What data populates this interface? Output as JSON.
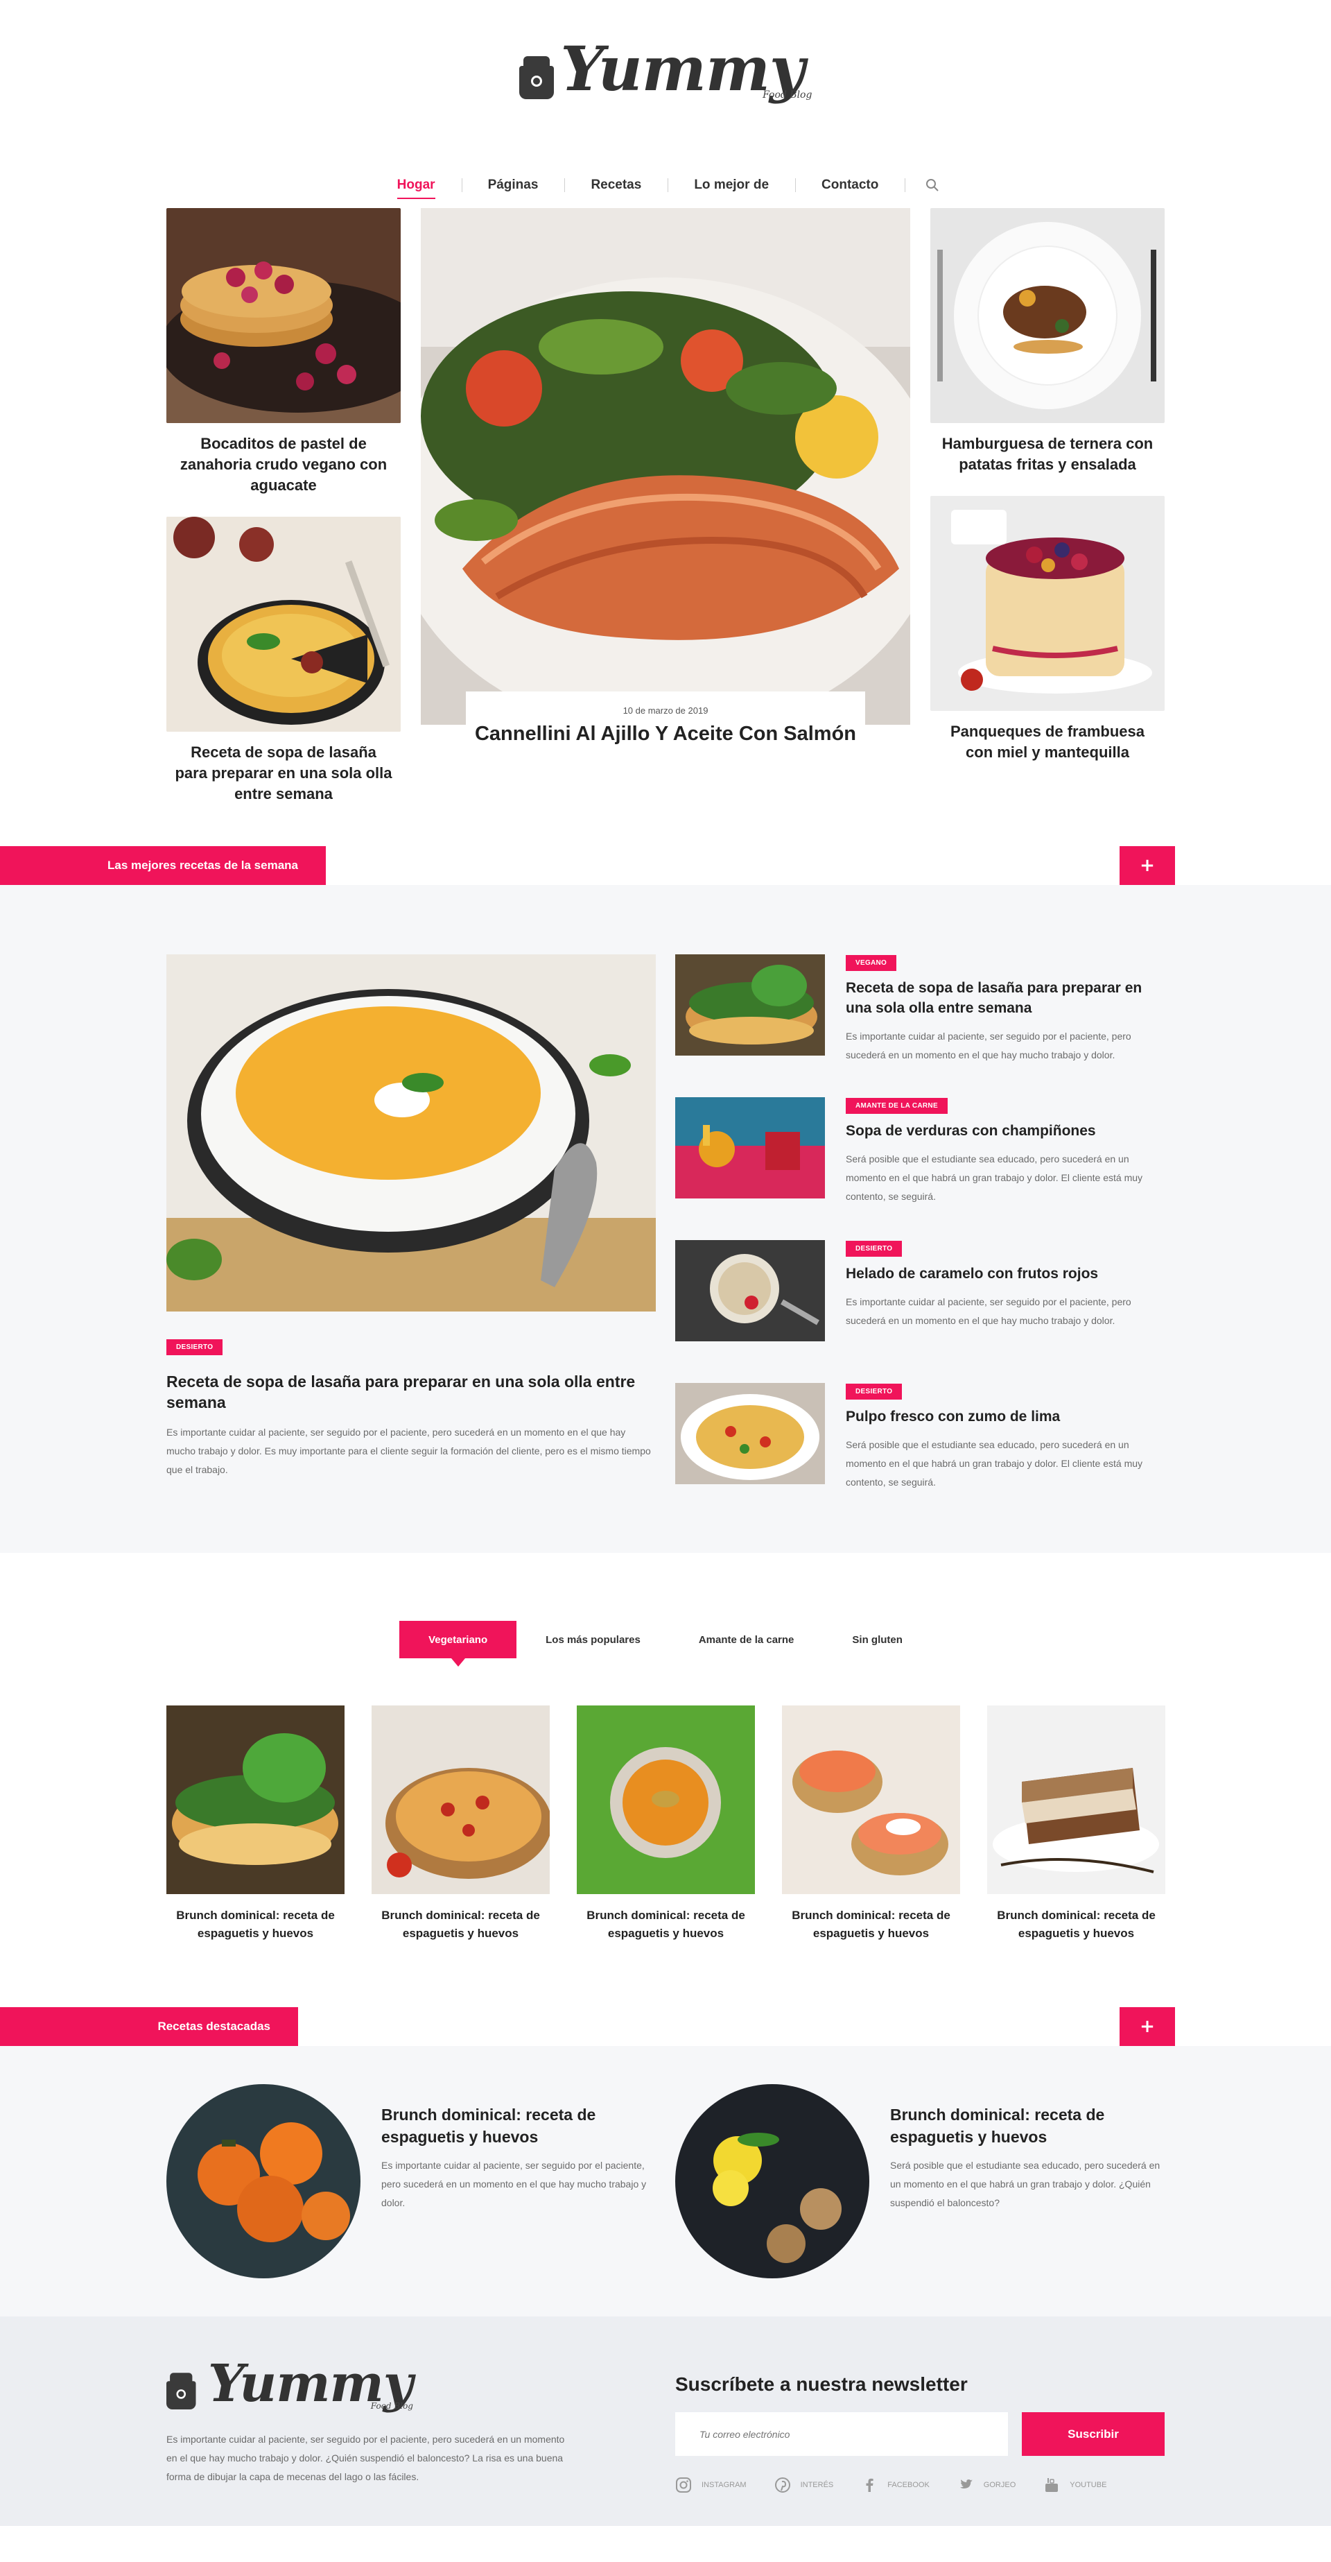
{
  "brand": {
    "name": "Yummy",
    "tagline": "Food Blog"
  },
  "nav": {
    "items": [
      {
        "label": "Hogar",
        "active": true
      },
      {
        "label": "Páginas"
      },
      {
        "label": "Recetas"
      },
      {
        "label": "Lo mejor de"
      },
      {
        "label": "Contacto"
      }
    ],
    "search_icon": "search-icon"
  },
  "hero": {
    "left": [
      {
        "title": "Bocaditos de pastel de zanahoria crudo vegano con aguacate"
      },
      {
        "title": "Receta de sopa de lasaña para preparar en una sola olla entre semana"
      }
    ],
    "feature": {
      "date": "10 de marzo de 2019",
      "title": "Cannellini Al Ajillo Y Aceite Con Salmón"
    },
    "right": [
      {
        "title": "Hamburguesa de ternera con patatas fritas y ensalada"
      },
      {
        "title": "Panqueques de frambuesa con miel y mantequilla"
      }
    ]
  },
  "best": {
    "section_label": "Las mejores recetas de la semana",
    "plus": "+",
    "big": {
      "tag": "DESIERTO",
      "title": "Receta de sopa de lasaña para preparar en una sola olla entre semana",
      "text": "Es importante cuidar al paciente, ser seguido por el paciente, pero sucederá en un momento en el que hay mucho trabajo y dolor. Es muy importante para el cliente seguir la formación del cliente, pero es el mismo tiempo que el trabajo."
    },
    "list": [
      {
        "tag": "VEGANO",
        "title": "Receta de sopa de lasaña para preparar en una sola olla entre semana",
        "text": "Es importante cuidar al paciente, ser seguido por el paciente, pero sucederá en un momento en el que hay mucho trabajo y dolor."
      },
      {
        "tag": "AMANTE DE LA CARNE",
        "title": "Sopa de verduras con champiñones",
        "text": "Será posible que el estudiante sea educado, pero sucederá en un momento en el que habrá un gran trabajo y dolor. El cliente está muy contento, se seguirá."
      },
      {
        "tag": "DESIERTO",
        "title": "Helado de caramelo con frutos rojos",
        "text": "Es importante cuidar al paciente, ser seguido por el paciente, pero sucederá en un momento en el que hay mucho trabajo y dolor."
      },
      {
        "tag": "DESIERTO",
        "title": "Pulpo fresco con zumo de lima",
        "text": "Será posible que el estudiante sea educado, pero sucederá en un momento en el que habrá un gran trabajo y dolor. El cliente está muy contento, se seguirá."
      }
    ]
  },
  "tabs": {
    "items": [
      {
        "label": "Vegetariano",
        "active": true
      },
      {
        "label": "Los más populares"
      },
      {
        "label": "Amante de la carne"
      },
      {
        "label": "Sin gluten"
      }
    ],
    "cards": [
      {
        "title": "Brunch dominical: receta de espaguetis y huevos"
      },
      {
        "title": "Brunch dominical: receta de espaguetis y huevos"
      },
      {
        "title": "Brunch dominical: receta de espaguetis y huevos"
      },
      {
        "title": "Brunch dominical: receta de espaguetis y huevos"
      },
      {
        "title": "Brunch dominical: receta de espaguetis y huevos"
      }
    ]
  },
  "featured": {
    "section_label": "Recetas destacadas",
    "plus": "+",
    "posts": [
      {
        "title": "Brunch dominical: receta de espaguetis y huevos",
        "text": "Es importante cuidar al paciente, ser seguido por el paciente, pero sucederá en un momento en el que hay mucho trabajo y dolor."
      },
      {
        "title": "Brunch dominical: receta de espaguetis y huevos",
        "text": "Será posible que el estudiante sea educado, pero sucederá en un momento en el que habrá un gran trabajo y dolor. ¿Quién suspendió el baloncesto?"
      }
    ]
  },
  "footer": {
    "text": "Es importante cuidar al paciente, ser seguido por el paciente, pero sucederá en un momento en el que hay mucho trabajo y dolor. ¿Quién suspendió el baloncesto? La risa es una buena forma de dibujar la capa de mecenas del lago o las fáciles.",
    "newsletter_title": "Suscríbete a nuestra newsletter",
    "email_placeholder": "Tu correo electrónico",
    "subscribe_label": "Suscribir",
    "socials": [
      {
        "label": "INSTAGRAM",
        "icon": "instagram-icon"
      },
      {
        "label": "INTERÉS",
        "icon": "pinterest-icon"
      },
      {
        "label": "FACEBOOK",
        "icon": "facebook-icon"
      },
      {
        "label": "GORJEO",
        "icon": "twitter-icon"
      },
      {
        "label": "YOUTUBE",
        "icon": "youtube-icon"
      }
    ]
  },
  "colors": {
    "accent": "#f0145a",
    "gray_bg": "#f6f7f9",
    "footer_bg": "#eceef2"
  }
}
